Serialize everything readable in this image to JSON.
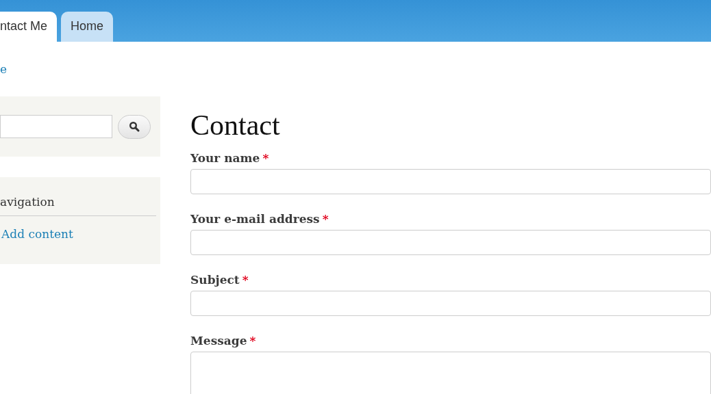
{
  "tabs": [
    {
      "label": "ntact Me",
      "selected": true
    },
    {
      "label": "Home",
      "selected": false
    }
  ],
  "breadcrumb": "e",
  "sidebar": {
    "navigation": {
      "title": "avigation",
      "links": [
        "Add content"
      ]
    }
  },
  "required_mark": "*",
  "form": {
    "title": "Contact",
    "fields": [
      {
        "label": "Your name",
        "required": true,
        "kind": "text"
      },
      {
        "label": "Your e-mail address",
        "required": true,
        "kind": "text"
      },
      {
        "label": "Subject",
        "required": true,
        "kind": "text"
      },
      {
        "label": "Message",
        "required": true,
        "kind": "textarea"
      }
    ]
  }
}
